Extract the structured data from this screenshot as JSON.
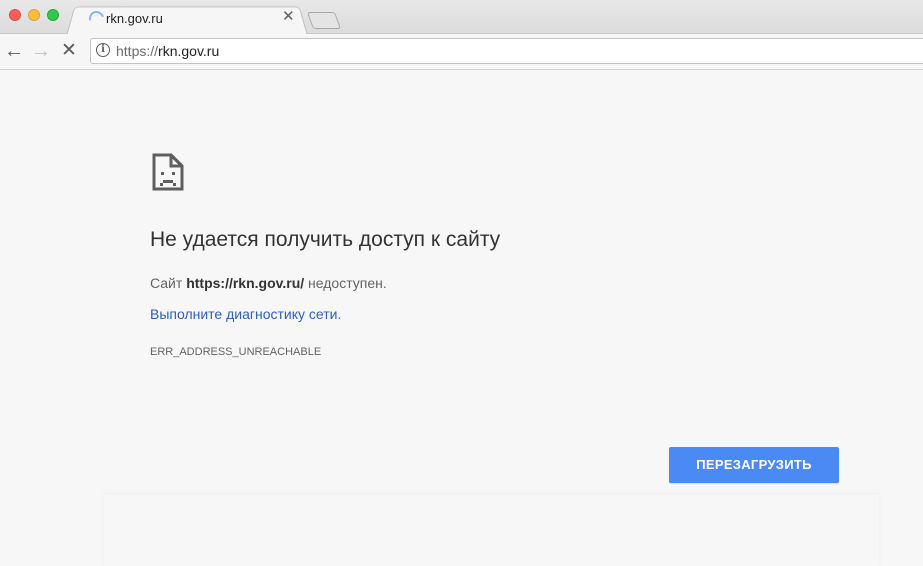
{
  "tab": {
    "title": "rkn.gov.ru",
    "close_glyph": "✕",
    "loading_icon": "spinner-icon"
  },
  "toolbar": {
    "back_glyph": "←",
    "forward_glyph": "→",
    "stop_glyph": "✕",
    "info_glyph": "i",
    "url_scheme": "https://",
    "url_host": "rkn.gov.ru"
  },
  "error": {
    "icon": "sad-page-icon",
    "heading": "Не удается получить доступ к сайту",
    "sub_prefix": "Сайт ",
    "sub_site": "https://rkn.gov.ru/",
    "sub_suffix": " недоступен.",
    "diagnostics_link": "Выполните диагностику сети",
    "diagnostics_tail": ".",
    "code": "ERR_ADDRESS_UNREACHABLE",
    "reload_label": "ПЕРЕЗАГРУЗИТЬ"
  },
  "colors": {
    "accent": "#4a8af4",
    "link": "#2f5fb8",
    "close": "#fc605c",
    "minimize": "#fdbc40",
    "maximize": "#34c84a"
  }
}
